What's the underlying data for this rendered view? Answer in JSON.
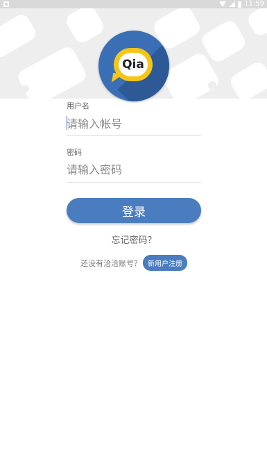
{
  "status_bar": {
    "time": "11:59",
    "icons": [
      "notification-icon",
      "wifi-icon",
      "signal-icon",
      "battery-icon"
    ]
  },
  "logo": {
    "text": "Qia"
  },
  "username": {
    "label": "用户名",
    "placeholder": "请输入帐号"
  },
  "password": {
    "label": "密码",
    "placeholder": "请输入密码"
  },
  "login_button": "登录",
  "forgot_password": "忘记密码？",
  "register": {
    "prompt": "还没有洽洽账号？",
    "button": "新用户注册"
  },
  "colors": {
    "primary": "#4a7cc0",
    "logo_bg": "#3a6fb5",
    "logo_bubble": "#f5c518",
    "header_bg": "#eeeeee"
  }
}
